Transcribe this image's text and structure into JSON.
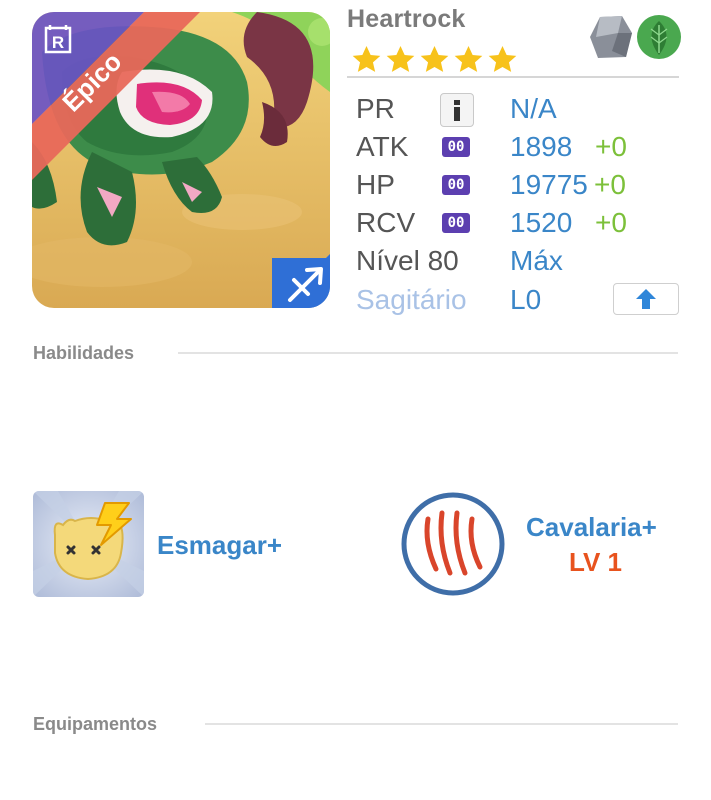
{
  "monster": {
    "name": "Heartrock",
    "rarity": "Épico",
    "rarity_color": "#e8685a",
    "star_count": 5,
    "star_color": "#f7c21b",
    "elements": [
      "stone-element-icon",
      "leaf-element-icon"
    ],
    "class_icon": "sagittarius-arrow-icon",
    "corner_badge_icon": "r-badge-icon"
  },
  "stats": {
    "pr_label": "PR",
    "pr_value": "N/A",
    "atk_label": "ATK",
    "atk_badge": "00",
    "atk_value": "1898",
    "atk_bonus": "+0",
    "hp_label": "HP",
    "hp_badge": "00",
    "hp_value": "19775",
    "hp_bonus": "+0",
    "rcv_label": "RCV",
    "rcv_badge": "00",
    "rcv_value": "1520",
    "rcv_bonus": "+0",
    "level_label": "Nível 80",
    "level_value": "Máx",
    "zodiac_label": "Sagitário",
    "zodiac_value": "L0"
  },
  "sections": {
    "skills_title": "Habilidades",
    "equipment_title": "Equipamentos"
  },
  "skills": [
    {
      "name": "Esmagar+",
      "icon": "knockout-lightning-icon"
    },
    {
      "name": "Cavalaria+",
      "level": "LV 1",
      "icon": "claw-scratch-icon"
    }
  ],
  "colors": {
    "accent_blue": "#3a86c8",
    "bonus_green": "#7cc03a",
    "level_orange": "#e8531e",
    "badge_purple": "#5c3fb0"
  }
}
